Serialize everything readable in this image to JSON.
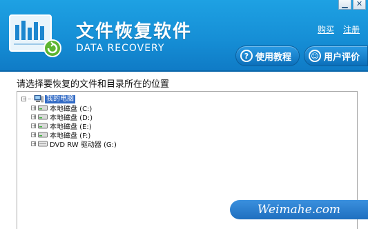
{
  "window": {
    "minimize_glyph": "▁",
    "close_glyph": "✕"
  },
  "header": {
    "title_cn": "文件恢复软件",
    "title_en": "DATA RECOVERY",
    "buy_link": "购买",
    "register_link": "注册",
    "tutorial_button": "使用教程",
    "review_button": "用户评价",
    "tutorial_icon": "?",
    "review_icon": "☺"
  },
  "main": {
    "prompt": "请选择要恢复的文件和目录所在的位置"
  },
  "tree": {
    "root": {
      "label": "我的电脑",
      "expander": "−"
    },
    "drives": [
      {
        "label": "本地磁盘 (C:)",
        "expander": "+"
      },
      {
        "label": "本地磁盘 (D:)",
        "expander": "+"
      },
      {
        "label": "本地磁盘 (E:)",
        "expander": "+"
      },
      {
        "label": "本地磁盘 (F:)",
        "expander": "+"
      },
      {
        "label": "DVD RW 驱动器 (G:)",
        "expander": "+"
      }
    ]
  },
  "watermark": {
    "text": "Weimahe.com"
  },
  "colors": {
    "header_blue": "#168fd6",
    "selection_blue": "#316ac5"
  }
}
